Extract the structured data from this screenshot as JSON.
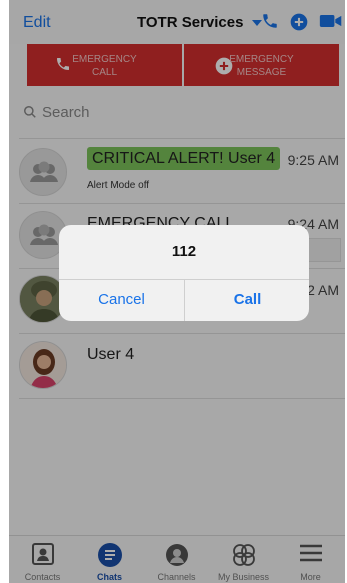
{
  "header": {
    "edit_label": "Edit",
    "title": "TOTR Services"
  },
  "emergency": {
    "call_line1": "EMERGENCY",
    "call_line2": "CALL",
    "message_line1": "EMERGENCY",
    "message_line2": "MESSAGE"
  },
  "search": {
    "placeholder": "Search"
  },
  "chats": [
    {
      "title": "CRITICAL ALERT! User 4",
      "time": "9:25 AM",
      "subtitle": "Alert Mode off"
    },
    {
      "title": "EMERGENCY CALL",
      "time": "9:24 AM",
      "subtitle": ""
    },
    {
      "title": "",
      "time": "9:22 AM",
      "subtitle": ""
    },
    {
      "title": "User 4",
      "time": "",
      "subtitle": ""
    }
  ],
  "dialog": {
    "message": "112",
    "cancel_label": "Cancel",
    "call_label": "Call"
  },
  "tabs": [
    {
      "label": "Contacts",
      "icon": "contacts-icon"
    },
    {
      "label": "Chats",
      "icon": "chats-icon",
      "active": true
    },
    {
      "label": "Channels",
      "icon": "channels-icon"
    },
    {
      "label": "My Business",
      "icon": "my-business-icon"
    },
    {
      "label": "More",
      "icon": "more-icon"
    }
  ],
  "colors": {
    "accent": "#1a73e8",
    "emergency": "#d32f2f",
    "alert_green": "#7cc35a"
  }
}
